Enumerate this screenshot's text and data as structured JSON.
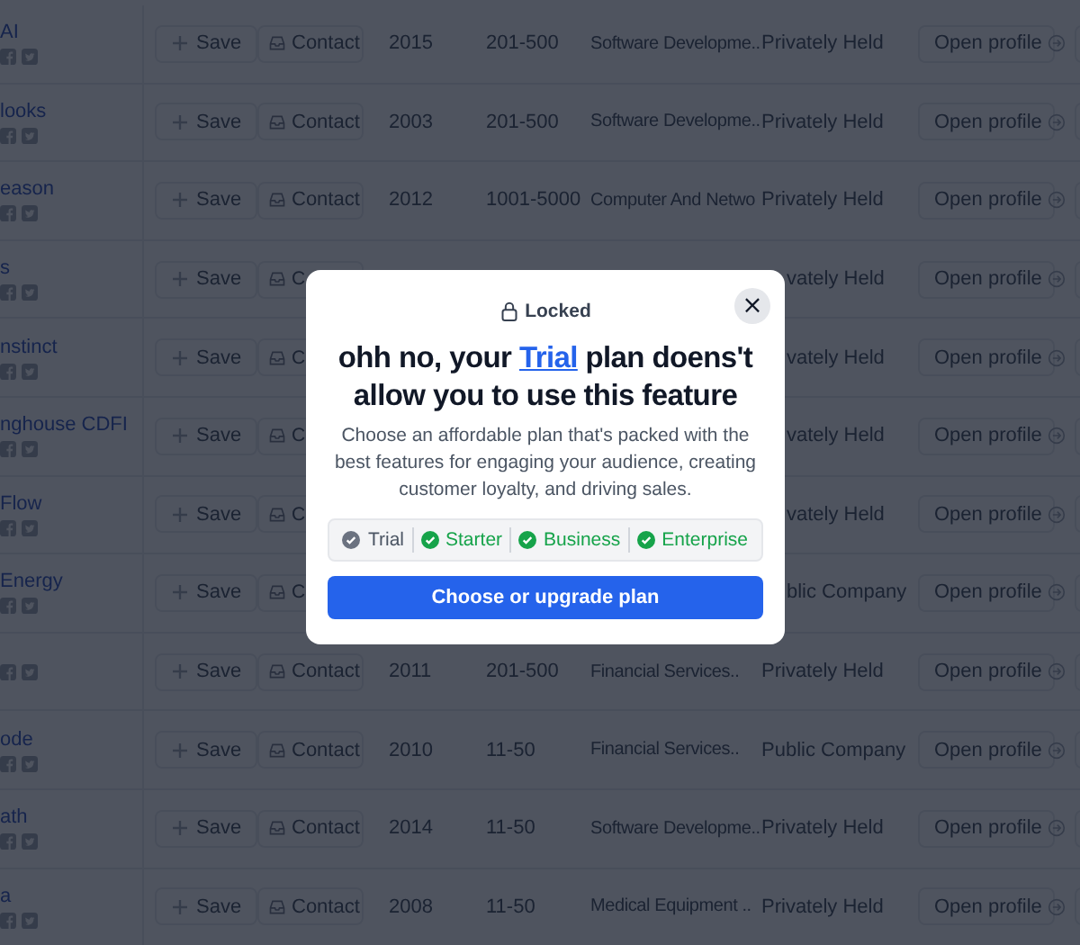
{
  "rows": [
    {
      "name": "AI",
      "save": "Save",
      "contact": "Contact",
      "year": "2015",
      "size": "201-500",
      "industry": "Software Developme..",
      "type": "Privately Held",
      "open": "Open profile",
      "covered": false
    },
    {
      "name": "looks",
      "save": "Save",
      "contact": "Contact",
      "year": "2003",
      "size": "201-500",
      "industry": "Software Developme..",
      "type": "Privately Held",
      "open": "Open profile",
      "covered": false
    },
    {
      "name": "eason",
      "save": "Save",
      "contact": "Contact",
      "year": "2012",
      "size": "1001-5000",
      "industry": "Computer And Netwo",
      "type": "Privately Held",
      "open": "Open profile",
      "covered": false
    },
    {
      "name": "s",
      "save": "Save",
      "contact": "C",
      "type": "vately Held",
      "open": "Open profile",
      "covered": true
    },
    {
      "name": "nstinct",
      "save": "Save",
      "contact": "C",
      "type": "vately Held",
      "open": "Open profile",
      "covered": true
    },
    {
      "name": "nghouse CDFI",
      "save": "Save",
      "contact": "C",
      "type": "vately Held",
      "open": "Open profile",
      "covered": true
    },
    {
      "name": "Flow",
      "save": "Save",
      "contact": "C",
      "type": "vately Held",
      "open": "Open profile",
      "covered": true
    },
    {
      "name": "Energy",
      "save": "Save",
      "contact": "C",
      "type": "blic Company",
      "open": "Open profile",
      "covered": true
    },
    {
      "save": "Save",
      "contact": "Contact",
      "year": "2011",
      "size": "201-500",
      "industry": "Financial Services..",
      "type": "Privately Held",
      "open": "Open profile",
      "covered": false
    },
    {
      "name": "ode",
      "save": "Save",
      "contact": "Contact",
      "year": "2010",
      "size": "11-50",
      "industry": "Financial Services..",
      "type": "Public Company",
      "open": "Open profile",
      "covered": false
    },
    {
      "name": "ath",
      "save": "Save",
      "contact": "Contact",
      "year": "2014",
      "size": "11-50",
      "industry": "Software Developme..",
      "type": "Privately Held",
      "open": "Open profile",
      "covered": false
    },
    {
      "name": "a",
      "save": "Save",
      "contact": "Contact",
      "year": "2008",
      "size": "11-50",
      "industry": "Medical Equipment ..",
      "type": "Privately Held",
      "open": "Open profile",
      "covered": false
    }
  ],
  "modal": {
    "badge": "Locked",
    "close": "×",
    "title_before": "ohh no, your",
    "title_link": "Trial",
    "title_after": "plan doens't allow you to use this feature",
    "description": "Choose an affordable plan that's packed with the best features for engaging your audience, creating customer loyalty, and driving sales.",
    "plans": [
      {
        "label": "Trial",
        "included": false
      },
      {
        "label": "Starter",
        "included": true
      },
      {
        "label": "Business",
        "included": true
      },
      {
        "label": "Enterprise",
        "included": true
      }
    ],
    "button": "Choose or upgrade plan"
  }
}
